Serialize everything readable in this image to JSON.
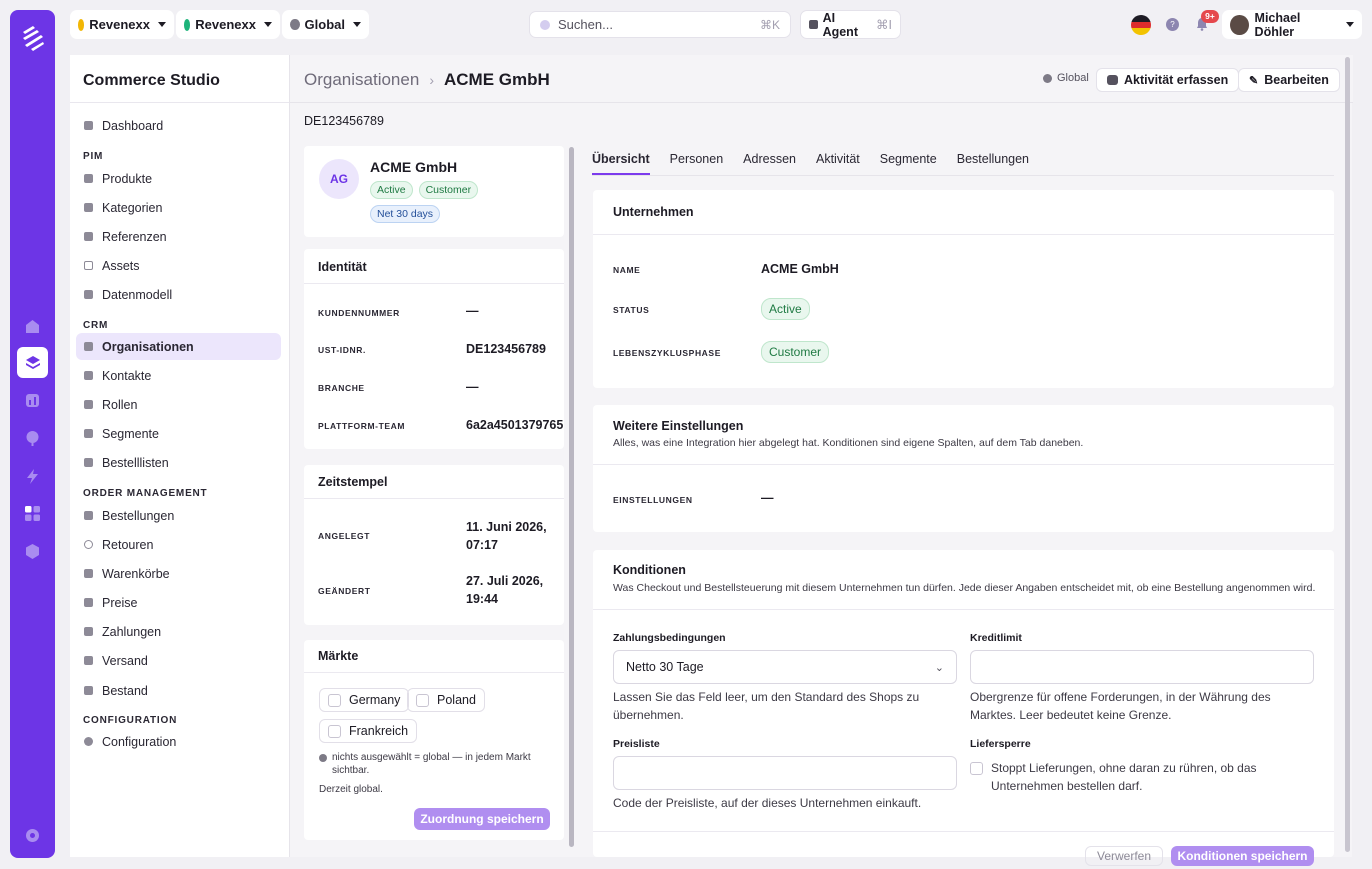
{
  "topbar": {
    "org_selector": "Revenexx",
    "channel_selector": "Revenexx",
    "scope_selector": "Global",
    "search_placeholder": "Suchen...",
    "search_shortcut": "⌘K",
    "ai_agent_label": "AI Agent",
    "ai_agent_shortcut": "⌘I",
    "notification_badge": "9+",
    "user_name": "Michael Döhler",
    "colors": {
      "accent": "#6d35e6",
      "notification": "#e5484d"
    }
  },
  "sidebar": {
    "title": "Commerce Studio",
    "dashboard": "Dashboard",
    "sections": [
      {
        "heading": "PIM",
        "items": [
          "Produkte",
          "Kategorien",
          "Referenzen",
          "Assets",
          "Datenmodell"
        ]
      },
      {
        "heading": "CRM",
        "items": [
          "Organisationen",
          "Kontakte",
          "Rollen",
          "Segmente",
          "Bestelllisten"
        ]
      },
      {
        "heading": "ORDER MANAGEMENT",
        "items": [
          "Bestellungen",
          "Retouren",
          "Warenkörbe",
          "Preise",
          "Zahlungen",
          "Versand",
          "Bestand"
        ]
      },
      {
        "heading": "CONFIGURATION",
        "items": [
          "Configuration"
        ]
      }
    ],
    "active_item": "Organisationen"
  },
  "header": {
    "breadcrumb_parent": "Organisationen",
    "breadcrumb_current": "ACME GmbH",
    "scope": "Global",
    "log_activity_button": "Aktivität erfassen",
    "edit_button": "Bearbeiten"
  },
  "vat_id": "DE123456789",
  "profile": {
    "initials": "AG",
    "name": "ACME GmbH",
    "badges": [
      "Active",
      "Customer",
      "Net 30 days"
    ]
  },
  "identity": {
    "title": "Identität",
    "rows": [
      {
        "label": "KUNDENNUMMER",
        "value": "—"
      },
      {
        "label": "UST-IDNR.",
        "value": "DE123456789"
      },
      {
        "label": "BRANCHE",
        "value": "—"
      },
      {
        "label": "PLATTFORM-TEAM",
        "value": "6a2a4501379765"
      }
    ]
  },
  "timestamps": {
    "title": "Zeitstempel",
    "rows": [
      {
        "label": "ANGELEGT",
        "value_line1": "11. Juni 2026,",
        "value_line2": "07:17"
      },
      {
        "label": "GEÄNDERT",
        "value_line1": "27. Juli 2026,",
        "value_line2": "19:44"
      }
    ]
  },
  "markets": {
    "title": "Märkte",
    "options": [
      "Germany",
      "Poland",
      "Frankreich"
    ],
    "hint_line1": "nichts ausgewählt = global — in jedem Markt",
    "hint_line2": "sichtbar.",
    "current": "Derzeit global.",
    "save_button": "Zuordnung speichern"
  },
  "tabs": [
    "Übersicht",
    "Personen",
    "Adressen",
    "Aktivität",
    "Segmente",
    "Bestellungen"
  ],
  "company": {
    "title": "Unternehmen",
    "name_label": "NAME",
    "name_value": "ACME GmbH",
    "status_label": "STATUS",
    "status_value": "Active",
    "lifecycle_label": "LEBENSZYKLUSPHASE",
    "lifecycle_value": "Customer"
  },
  "settings": {
    "title": "Weitere Einstellungen",
    "subtitle": "Alles, was eine Integration hier abgelegt hat. Konditionen sind eigene Spalten, auf dem Tab daneben.",
    "label": "EINSTELLUNGEN",
    "value": "—"
  },
  "conditions": {
    "title": "Konditionen",
    "subtitle": "Was Checkout und Bestellsteuerung mit diesem Unternehmen tun dürfen. Jede dieser Angaben entscheidet mit, ob eine Bestellung angenommen wird.",
    "payment_terms_label": "Zahlungsbedingungen",
    "payment_terms_value": "Netto 30 Tage",
    "payment_terms_help_1": "Lassen Sie das Feld leer, um den Standard des Shops zu",
    "payment_terms_help_2": "übernehmen.",
    "credit_limit_label": "Kreditlimit",
    "credit_limit_value": "",
    "credit_limit_help_1": "Obergrenze für offene Forderungen, in der Währung des",
    "credit_limit_help_2": "Marktes. Leer bedeutet keine Grenze.",
    "price_list_label": "Preisliste",
    "price_list_value": "",
    "price_list_help": "Code der Preisliste, auf der dieses Unternehmen einkauft.",
    "delivery_block_label": "Liefersperre",
    "delivery_block_help_1": "Stoppt Lieferungen, ohne daran zu rühren, ob das",
    "delivery_block_help_2": "Unternehmen bestellen darf.",
    "discard_button": "Verwerfen",
    "save_button": "Konditionen speichern"
  }
}
